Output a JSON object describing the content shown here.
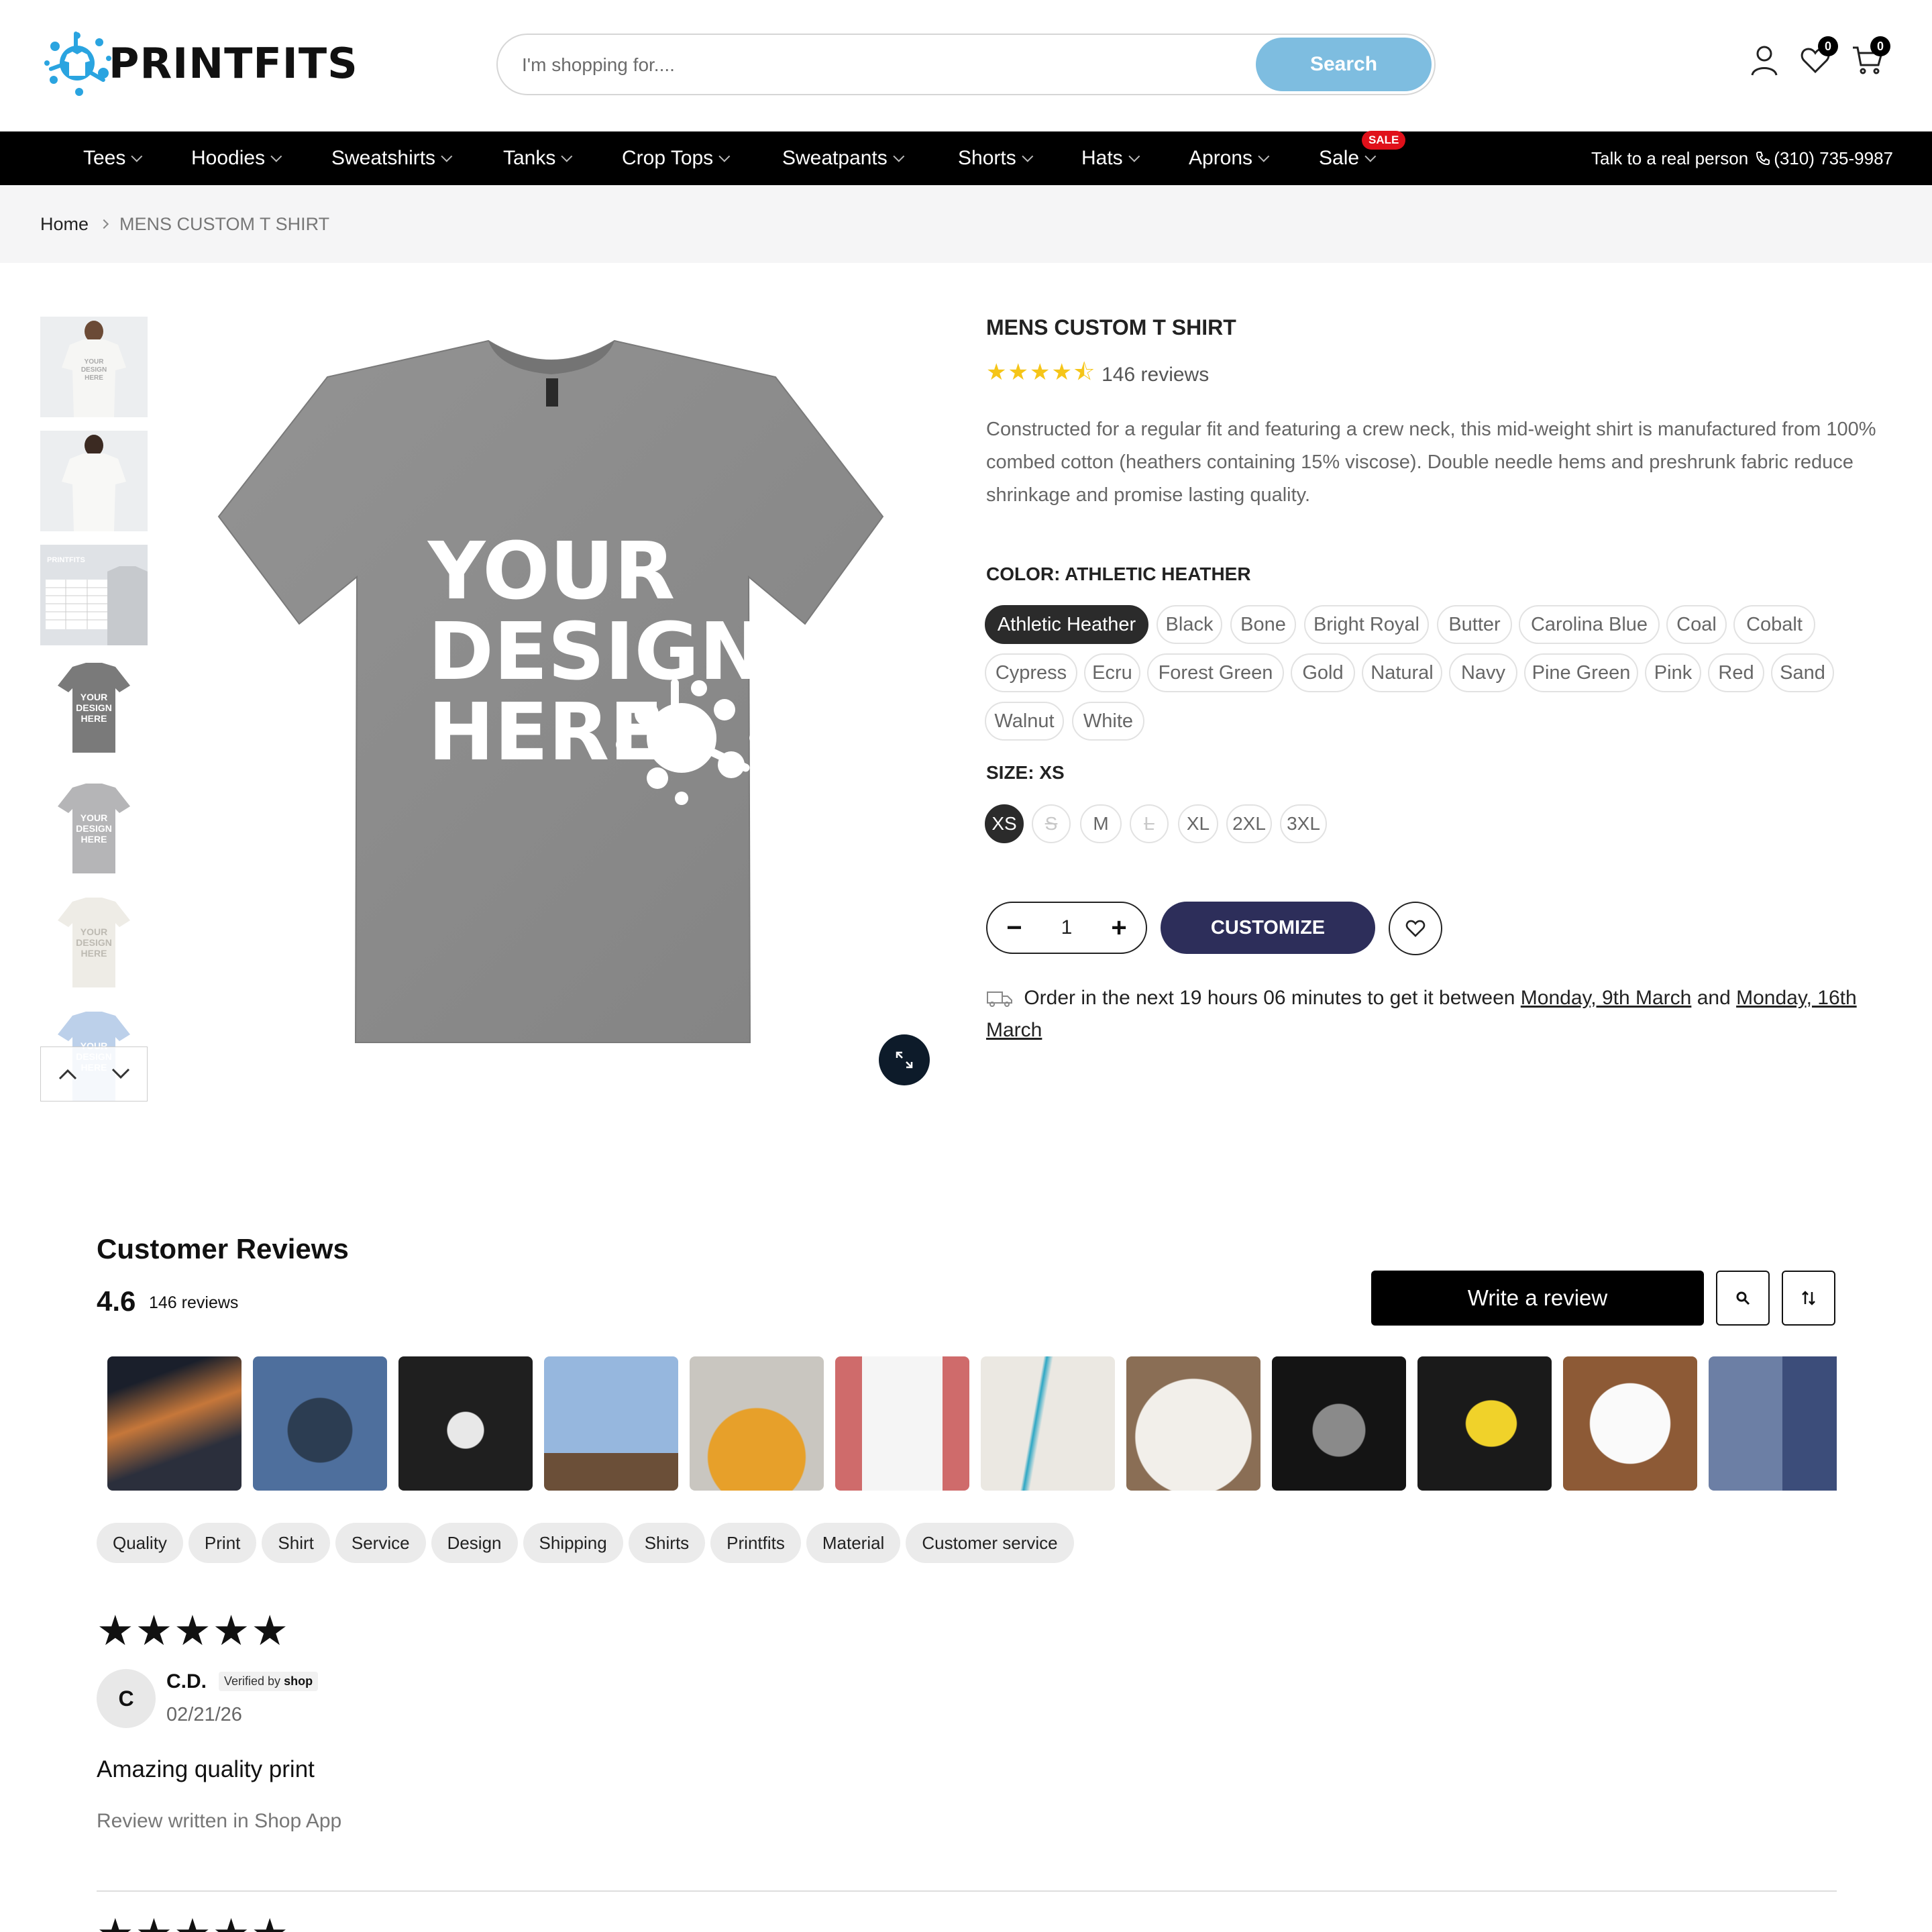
{
  "header": {
    "logo_text": "PRINTFITS",
    "search_placeholder": "I'm shopping for....",
    "search_button": "Search",
    "wishlist_count": "0",
    "cart_count": "0"
  },
  "nav": {
    "items": [
      "Tees",
      "Hoodies",
      "Sweatshirts",
      "Tanks",
      "Crop Tops",
      "Sweatpants",
      "Shorts",
      "Hats",
      "Aprons",
      "Sale"
    ],
    "sale_badge": "SALE",
    "contact_text": "Talk to a real person",
    "phone": "(310) 735-9987"
  },
  "breadcrumb": {
    "home": "Home",
    "current": "MENS CUSTOM T SHIRT"
  },
  "gallery": {
    "main_text_lines": [
      "YOUR",
      "DESIGN",
      "HERE"
    ],
    "thumb_text": "YOUR DESIGN HERE",
    "size_chart_brand": "PRINTFITS",
    "colors": {
      "tee_main": "#8a8a8a",
      "tee_light_gray": "#b5b5b7",
      "tee_natural": "#eeece6",
      "tee_blue": "#bcd0ea"
    }
  },
  "product": {
    "title": "MENS CUSTOM T SHIRT",
    "rating": 4.5,
    "stars": "★★★★⯪",
    "reviews_label": "146 reviews",
    "description": "Constructed for a regular fit and featuring a crew neck, this mid-weight shirt is manufactured from 100% combed cotton (heathers containing 15% viscose). Double needle hems and preshrunk fabric reduce shrinkage and promise lasting quality.",
    "color_label": "COLOR: ATHLETIC HEATHER",
    "colors": [
      "Athletic Heather",
      "Black",
      "Bone",
      "Bright Royal",
      "Butter",
      "Carolina Blue",
      "Coal",
      "Cobalt",
      "Cypress",
      "Ecru",
      "Forest Green",
      "Gold",
      "Natural",
      "Navy",
      "Pine Green",
      "Pink",
      "Red",
      "Sand",
      "Walnut",
      "White"
    ],
    "selected_color": "Athletic Heather",
    "size_label": "SIZE: XS",
    "sizes": [
      "XS",
      "S",
      "M",
      "L",
      "XL",
      "2XL",
      "3XL"
    ],
    "selected_size": "XS",
    "unavailable_sizes": [
      "S",
      "L"
    ],
    "quantity": "1",
    "qty_minus": "−",
    "qty_plus": "+",
    "customize_button": "CUSTOMIZE",
    "delivery_prefix": "Order in the next 19 hours 06 minutes to get it between",
    "delivery_start": "Monday, 9th March",
    "delivery_and": "and",
    "delivery_end": "Monday, 16th March",
    "accent_color": "#2d2e5a",
    "star_color": "#f5c518"
  },
  "reviews": {
    "title": "Customer Reviews",
    "average": "4.6",
    "count_label": "146 reviews",
    "write_button": "Write a review",
    "tags": [
      "Quality",
      "Print",
      "Shirt",
      "Service",
      "Design",
      "Shipping",
      "Shirts",
      "Printfits",
      "Material",
      "Customer service"
    ],
    "first_review": {
      "stars": "★★★★★",
      "avatar_initial": "C",
      "name": "C.D.",
      "verified_prefix": "Verified by",
      "verified_brand": "shop",
      "date": "02/21/26",
      "heading": "Amazing quality print",
      "body": "Review written in Shop App"
    },
    "next_review_stars": "★★★★★"
  }
}
